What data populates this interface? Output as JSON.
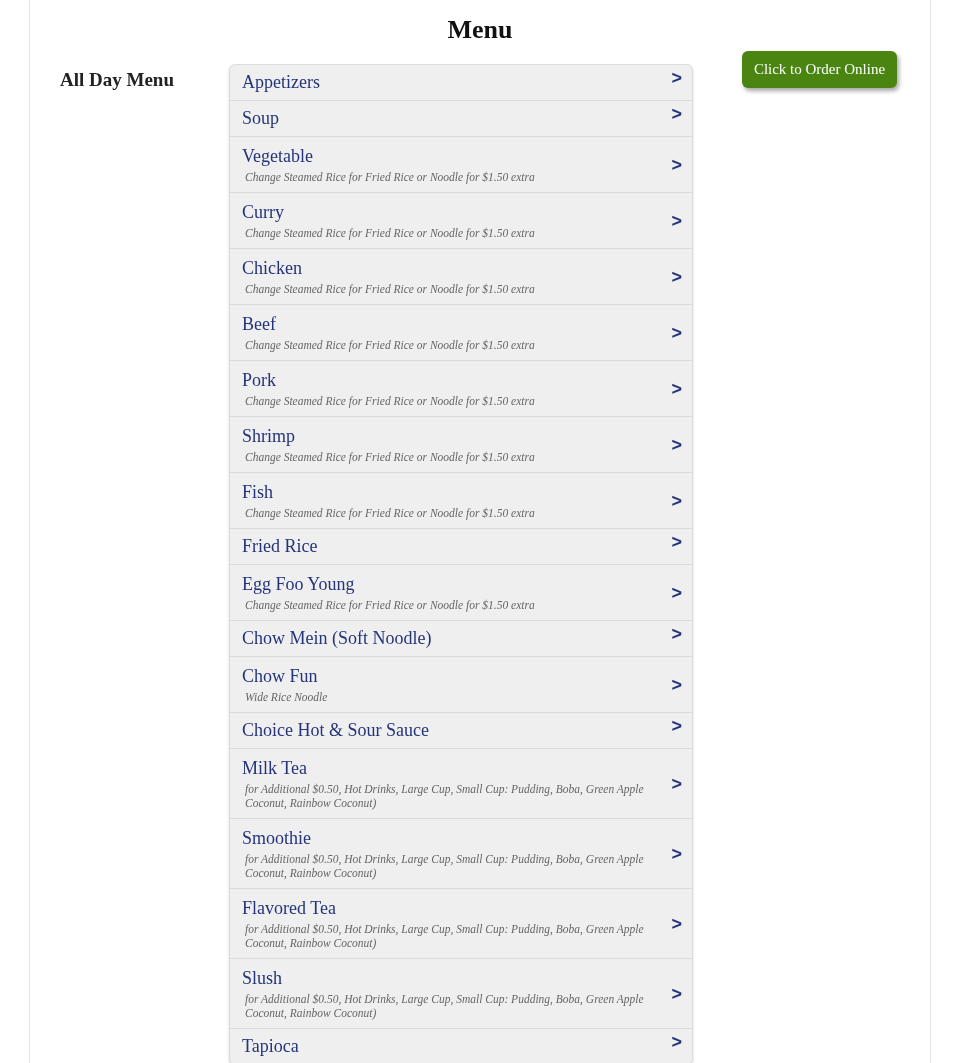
{
  "title": "Menu",
  "section_label": "All Day Menu",
  "order_button": "Click to Order Online",
  "categories": [
    {
      "name": "Appetizers",
      "arrow": ">"
    },
    {
      "name": "Soup",
      "arrow": ">"
    },
    {
      "name": "Vegetable",
      "note": "Change Steamed Rice for Fried Rice or Noodle for $1.50 extra",
      "arrow": ">"
    },
    {
      "name": "Curry",
      "note": "Change Steamed Rice for Fried Rice or Noodle for $1.50 extra",
      "arrow": ">"
    },
    {
      "name": "Chicken",
      "note": "Change Steamed Rice for Fried Rice or Noodle for $1.50 extra",
      "arrow": ">"
    },
    {
      "name": "Beef",
      "note": "Change Steamed Rice for Fried Rice or Noodle for $1.50 extra",
      "arrow": ">"
    },
    {
      "name": "Pork",
      "note": "Change Steamed Rice for Fried Rice or Noodle for $1.50 extra",
      "arrow": ">"
    },
    {
      "name": "Shrimp",
      "note": "Change Steamed Rice for Fried Rice or Noodle for $1.50 extra",
      "arrow": ">"
    },
    {
      "name": "Fish",
      "note": "Change Steamed Rice for Fried Rice or Noodle for $1.50 extra",
      "arrow": ">"
    },
    {
      "name": "Fried Rice",
      "arrow": ">"
    },
    {
      "name": "Egg Foo Young",
      "note": "Change Steamed Rice for Fried Rice or Noodle for $1.50 extra",
      "arrow": ">"
    },
    {
      "name": "Chow Mein (Soft Noodle)",
      "arrow": ">"
    },
    {
      "name": "Chow Fun",
      "note": "Wide Rice Noodle",
      "arrow": ">"
    },
    {
      "name": "Choice Hot & Sour Sauce",
      "arrow": ">"
    },
    {
      "name": "Milk Tea",
      "note": "for Additional $0.50, Hot Drinks, Large Cup, Small Cup: Pudding, Boba, Green Apple Coconut, Rainbow Coconut)",
      "arrow": ">"
    },
    {
      "name": "Smoothie",
      "note": "for Additional $0.50, Hot Drinks, Large Cup, Small Cup: Pudding, Boba, Green Apple Coconut, Rainbow Coconut)",
      "arrow": ">"
    },
    {
      "name": "Flavored Tea",
      "note": "for Additional $0.50, Hot Drinks, Large Cup, Small Cup: Pudding, Boba, Green Apple Coconut, Rainbow Coconut)",
      "arrow": ">"
    },
    {
      "name": "Slush",
      "note": "for Additional $0.50, Hot Drinks, Large Cup, Small Cup: Pudding, Boba, Green Apple Coconut, Rainbow Coconut)",
      "arrow": ">"
    },
    {
      "name": "Tapioca",
      "arrow": ">"
    }
  ]
}
